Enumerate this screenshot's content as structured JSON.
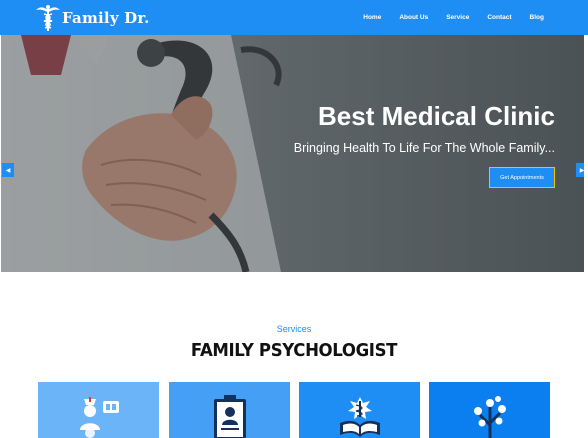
{
  "brand": {
    "name": "Family Dr.",
    "logo_icon": "caduceus-icon"
  },
  "nav": {
    "items": [
      {
        "label": "Home"
      },
      {
        "label": "About Us"
      },
      {
        "label": "Service"
      },
      {
        "label": "Contact"
      },
      {
        "label": "Blog"
      }
    ]
  },
  "hero": {
    "title": "Best Medical Clinic",
    "subtitle": "Bringing Health To Life For The Whole Family...",
    "button_label": "Get Appointments",
    "prev_icon": "chevron-left-icon",
    "next_icon": "chevron-right-icon"
  },
  "services": {
    "eyebrow": "Services",
    "title": "FAMILY PSYCHOLOGIST",
    "cards": [
      {
        "icon": "medical-staff-icon"
      },
      {
        "icon": "id-badge-icon"
      },
      {
        "icon": "medical-book-icon"
      },
      {
        "icon": "family-tree-icon"
      }
    ]
  },
  "colors": {
    "primary": "#1e8ef5",
    "button_border": "#f2c200",
    "text_dark": "#111111"
  }
}
